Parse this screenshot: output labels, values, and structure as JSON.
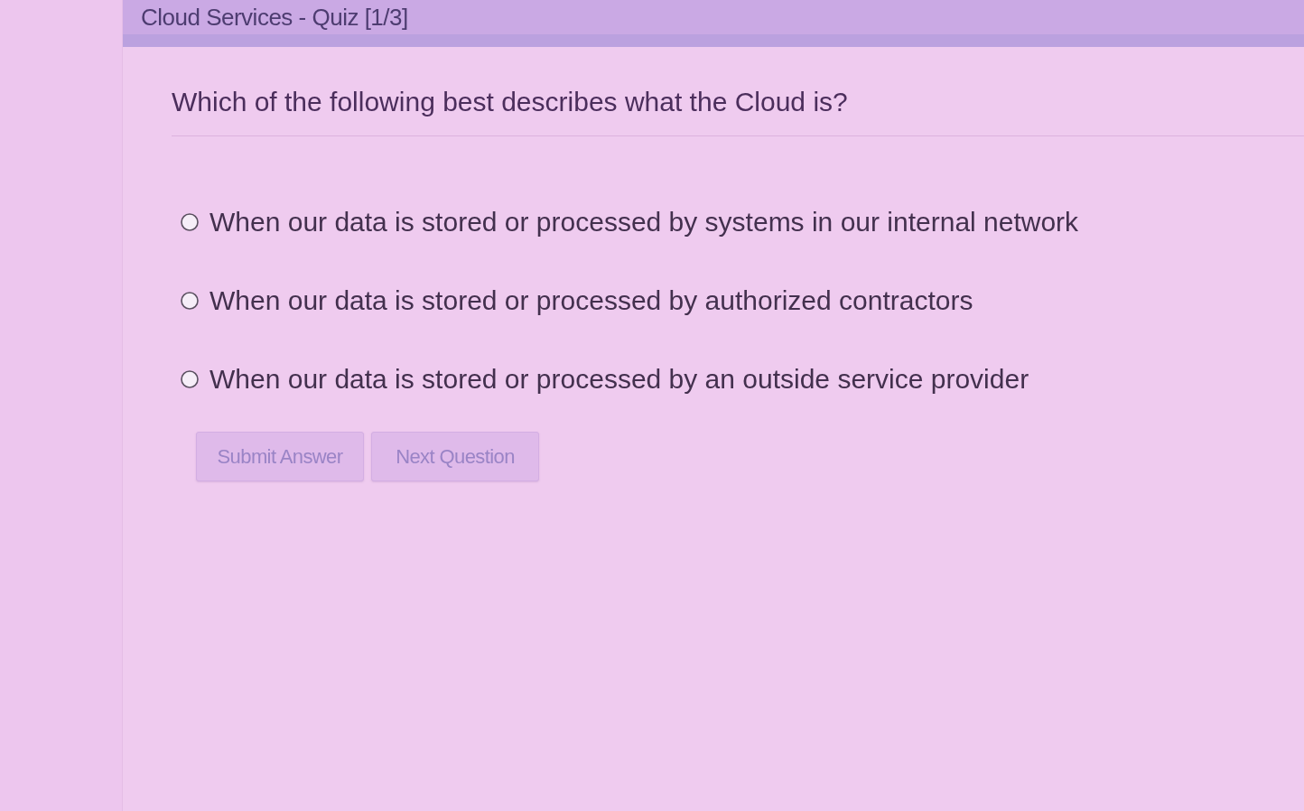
{
  "header": {
    "title": "Cloud Services - Quiz [1/3]"
  },
  "question": {
    "text": "Which of the following best describes what the Cloud is?"
  },
  "options": [
    {
      "label": "When our data is stored or processed by systems in our internal network",
      "selected": false
    },
    {
      "label": "When our data is stored or processed by authorized contractors",
      "selected": false
    },
    {
      "label": "When our data is stored or processed by an outside service provider",
      "selected": false
    }
  ],
  "buttons": [
    {
      "label": "Submit Answer",
      "disabled": true
    },
    {
      "label": "Next Question",
      "disabled": true
    }
  ]
}
